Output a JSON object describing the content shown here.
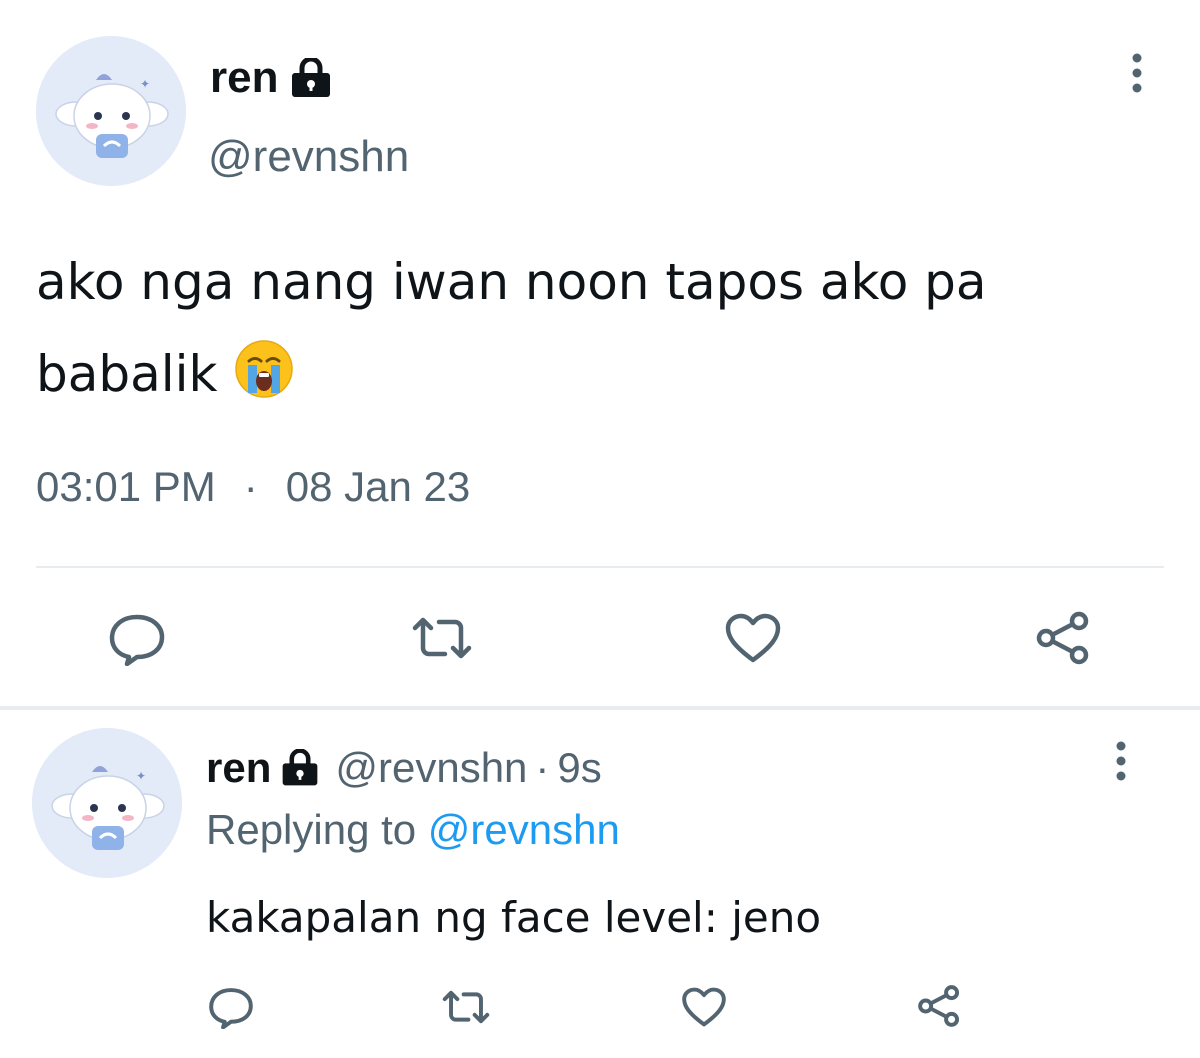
{
  "main_tweet": {
    "display_name": "ren",
    "handle": "@revnshn",
    "text_line1": "ako nga nang iwan noon tapos ako pa",
    "text_line2": "babalik",
    "emoji": "loudly-crying-face",
    "time": "03:01 PM",
    "separator": "·",
    "date": "08 Jan 23",
    "icons": {
      "lock": "lock-icon",
      "more": "more-vertical-icon",
      "reply": "reply-icon",
      "retweet": "retweet-icon",
      "like": "heart-icon",
      "share": "share-icon"
    }
  },
  "reply_tweet": {
    "display_name": "ren",
    "handle": "@revnshn",
    "separator": "·",
    "age": "9s",
    "replying_prefix": "Replying to",
    "replying_to": "@revnshn",
    "text": "kakapalan ng face level: jeno"
  },
  "colors": {
    "text_primary": "#0f1419",
    "text_secondary": "#536471",
    "accent": "#1d9bf0",
    "divider": "#e6ecf0",
    "avatar_bg": "#e3ebf8"
  }
}
